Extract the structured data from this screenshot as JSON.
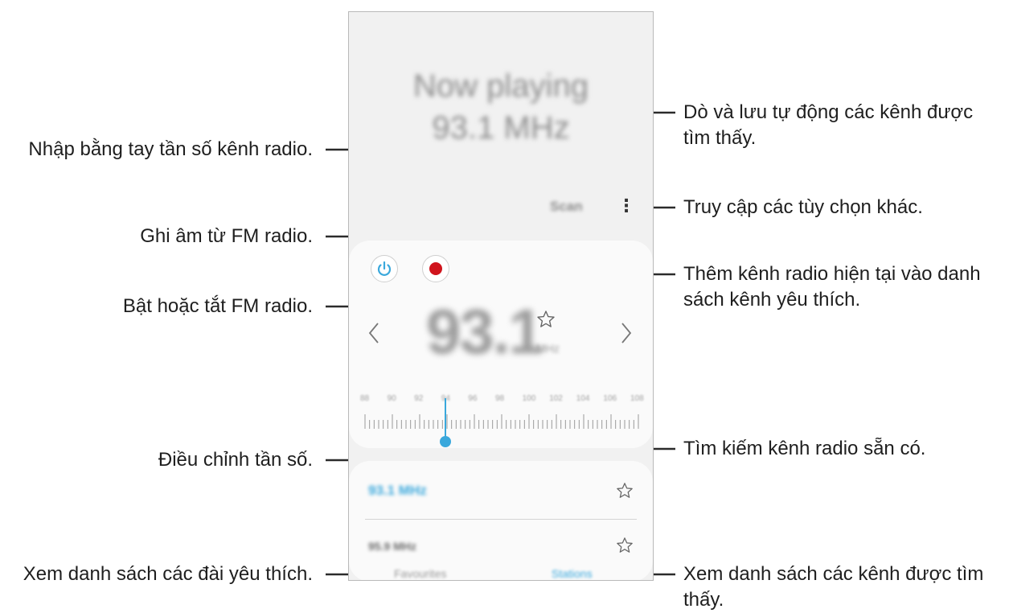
{
  "callouts": {
    "manual_frequency": "Nhập bằng tay tần số kênh radio.",
    "record": "Ghi âm từ FM radio.",
    "power": "Bật hoặc tắt FM radio.",
    "adjust_frequency": "Điều chỉnh tần số.",
    "favorites_list": "Xem danh sách các đài yêu thích.",
    "scan_line1": "Dò và lưu tự động các kênh được",
    "scan_line2": "tìm thấy.",
    "more_options": "Truy cập các tùy chọn khác.",
    "add_favorite_line1": "Thêm kênh radio hiện tại vào danh",
    "add_favorite_line2": "sách kênh yêu thích.",
    "search_stations": "Tìm kiếm kênh radio sẵn có.",
    "stations_list_line1": "Xem danh sách các kênh được tìm",
    "stations_list_line2": "thấy."
  },
  "phone": {
    "now_playing": "Now playing",
    "now_playing_freq": "93.1 MHz",
    "scan_label": "Scan",
    "current_freq": "93.1",
    "unit": "MHz",
    "dial_labels": [
      "88",
      "90",
      "92",
      "94",
      "96",
      "98",
      "100",
      "102",
      "104",
      "106",
      "108"
    ],
    "stations": [
      {
        "freq": "93.1 MHz",
        "active": true
      },
      {
        "freq": "95.9 MHz",
        "active": false
      }
    ],
    "tabs": {
      "favourites": "Favourites",
      "stations": "Stations"
    }
  },
  "colors": {
    "accent": "#3aa8dc",
    "record": "#d0141c",
    "leader": "#2b2b2b"
  }
}
